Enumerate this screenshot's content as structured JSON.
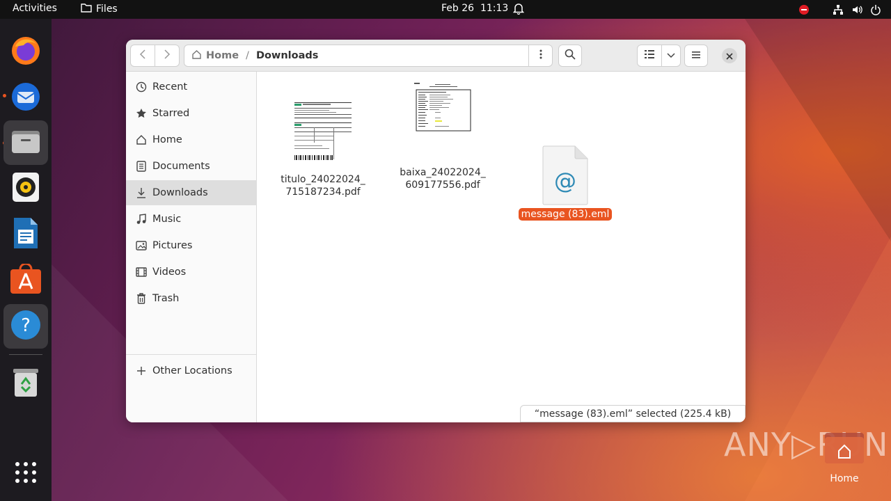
{
  "topbar": {
    "activities": "Activities",
    "app_name": "Files",
    "date": "Feb 26",
    "time": "11:13"
  },
  "dock": {
    "items": [
      "Firefox",
      "Thunderbird",
      "Files",
      "Rhythmbox",
      "LibreOffice Writer",
      "Ubuntu Software",
      "Help",
      "Trash"
    ],
    "apps_grid": "Show Applications"
  },
  "window": {
    "path": {
      "home": "Home",
      "separator": "/",
      "current": "Downloads"
    },
    "sidebar": {
      "items": [
        {
          "label": "Recent",
          "icon": "clock-icon"
        },
        {
          "label": "Starred",
          "icon": "star-icon"
        },
        {
          "label": "Home",
          "icon": "home-icon"
        },
        {
          "label": "Documents",
          "icon": "document-icon"
        },
        {
          "label": "Downloads",
          "icon": "download-icon"
        },
        {
          "label": "Music",
          "icon": "music-icon"
        },
        {
          "label": "Pictures",
          "icon": "picture-icon"
        },
        {
          "label": "Videos",
          "icon": "video-icon"
        },
        {
          "label": "Trash",
          "icon": "trash-icon"
        }
      ],
      "other_locations": "Other Locations",
      "selected": "Downloads"
    },
    "files": [
      {
        "line1": "titulo_24022024_",
        "line2": "715187234.pdf"
      },
      {
        "line1": "baixa_24022024_",
        "line2": "609177556.pdf"
      },
      {
        "line1": "message (83).eml",
        "line2": ""
      }
    ],
    "status": "“message (83).eml” selected (225.4 kB)"
  },
  "desktop": {
    "home_label": "Home",
    "watermark": "ANY RUN"
  },
  "colors": {
    "accent": "#e95420",
    "topbar": "#121212",
    "dock": "#1d1b20"
  }
}
